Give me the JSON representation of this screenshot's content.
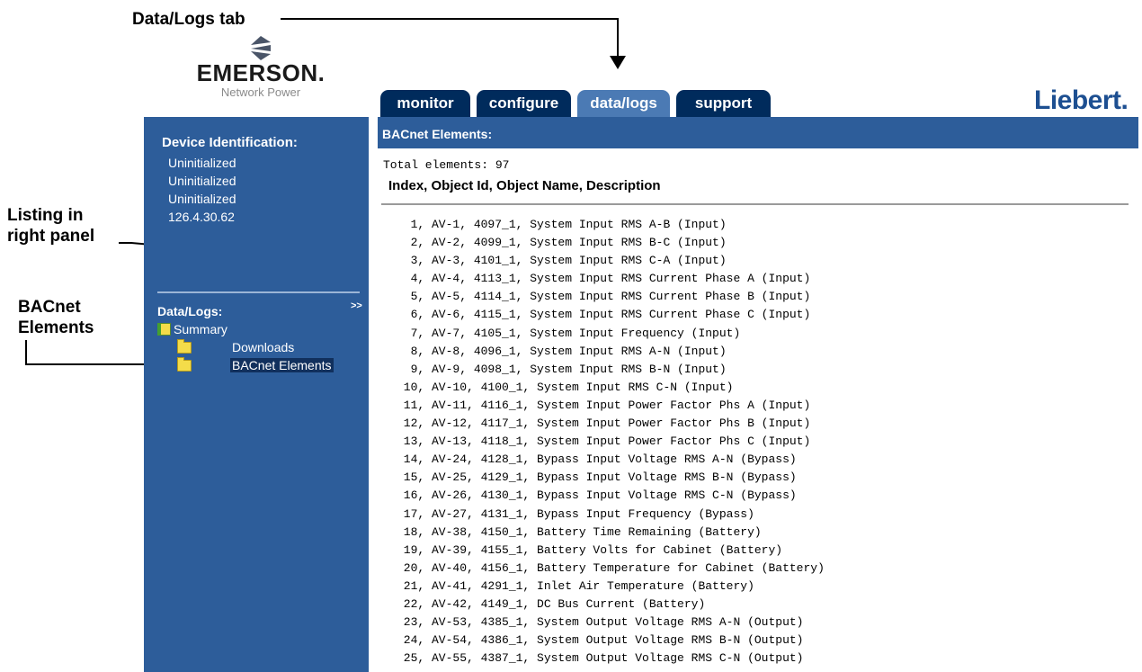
{
  "annotations": {
    "data_logs_tab": "Data/Logs tab",
    "listing_line1": "Listing in",
    "listing_line2": "right panel",
    "bacnet_line1": "BACnet",
    "bacnet_line2": "Elements"
  },
  "branding": {
    "emerson": "EMERSON.",
    "emerson_sub": "Network Power",
    "liebert": "Liebert."
  },
  "tabs": [
    {
      "label": "monitor",
      "active": false
    },
    {
      "label": "configure",
      "active": false
    },
    {
      "label": "data/logs",
      "active": true
    },
    {
      "label": "support",
      "active": false
    }
  ],
  "sidebar": {
    "device_title": "Device Identification:",
    "device_lines": [
      "Uninitialized",
      "Uninitialized",
      "Uninitialized",
      "126.4.30.62"
    ],
    "logs_title": "Data/Logs:",
    "expand": ">>",
    "tree": {
      "summary": "Summary",
      "downloads": "Downloads",
      "bacnet": "BACnet Elements"
    }
  },
  "content": {
    "header": "BACnet Elements:",
    "total": "Total elements: 97",
    "columns": "Index, Object Id, Object Name, Description",
    "rows": [
      "  1, AV-1, 4097_1, System Input RMS A-B (Input)",
      "  2, AV-2, 4099_1, System Input RMS B-C (Input)",
      "  3, AV-3, 4101_1, System Input RMS C-A (Input)",
      "  4, AV-4, 4113_1, System Input RMS Current Phase A (Input)",
      "  5, AV-5, 4114_1, System Input RMS Current Phase B (Input)",
      "  6, AV-6, 4115_1, System Input RMS Current Phase C (Input)",
      "  7, AV-7, 4105_1, System Input Frequency (Input)",
      "  8, AV-8, 4096_1, System Input RMS A-N (Input)",
      "  9, AV-9, 4098_1, System Input RMS B-N (Input)",
      " 10, AV-10, 4100_1, System Input RMS C-N (Input)",
      " 11, AV-11, 4116_1, System Input Power Factor Phs A (Input)",
      " 12, AV-12, 4117_1, System Input Power Factor Phs B (Input)",
      " 13, AV-13, 4118_1, System Input Power Factor Phs C (Input)",
      " 14, AV-24, 4128_1, Bypass Input Voltage RMS A-N (Bypass)",
      " 15, AV-25, 4129_1, Bypass Input Voltage RMS B-N (Bypass)",
      " 16, AV-26, 4130_1, Bypass Input Voltage RMS C-N (Bypass)",
      " 17, AV-27, 4131_1, Bypass Input Frequency (Bypass)",
      " 18, AV-38, 4150_1, Battery Time Remaining (Battery)",
      " 19, AV-39, 4155_1, Battery Volts for Cabinet (Battery)",
      " 20, AV-40, 4156_1, Battery Temperature for Cabinet (Battery)",
      " 21, AV-41, 4291_1, Inlet Air Temperature (Battery)",
      " 22, AV-42, 4149_1, DC Bus Current (Battery)",
      " 23, AV-53, 4385_1, System Output Voltage RMS A-N (Output)",
      " 24, AV-54, 4386_1, System Output Voltage RMS B-N (Output)",
      " 25, AV-55, 4387_1, System Output Voltage RMS C-N (Output)"
    ]
  },
  "colors": {
    "nav_blue": "#2d5d9a",
    "tab_dark": "#002b5c",
    "tab_active": "#4b7ab4",
    "liebert_blue": "#1d4f91"
  }
}
